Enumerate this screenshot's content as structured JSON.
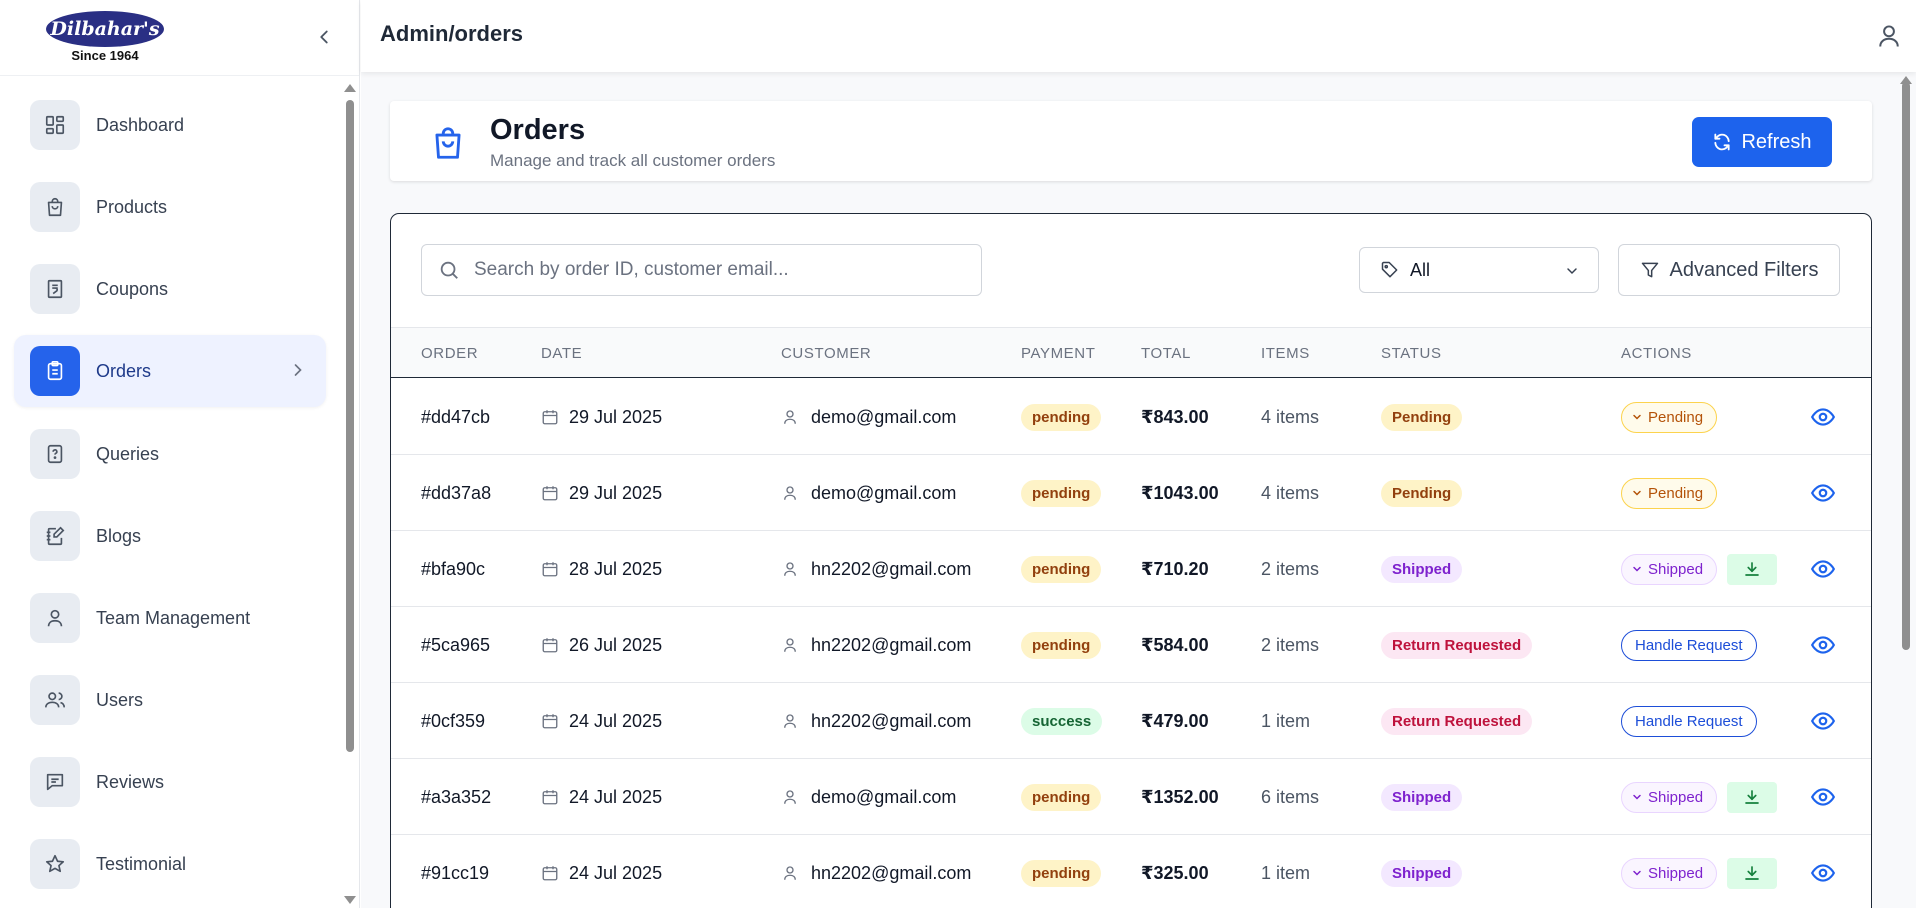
{
  "sidebar": {
    "brand_name": "Dilbahar's",
    "brand_tagline": "Since 1964",
    "items": [
      {
        "label": "Dashboard",
        "icon": "dashboard-icon"
      },
      {
        "label": "Products",
        "icon": "bag-icon"
      },
      {
        "label": "Coupons",
        "icon": "receipt-icon"
      },
      {
        "label": "Orders",
        "icon": "clipboard-icon",
        "active": true
      },
      {
        "label": "Queries",
        "icon": "question-file-icon"
      },
      {
        "label": "Blogs",
        "icon": "notebook-pen-icon"
      },
      {
        "label": "Team Management",
        "icon": "user-icon"
      },
      {
        "label": "Users",
        "icon": "users-icon"
      },
      {
        "label": "Reviews",
        "icon": "message-icon"
      },
      {
        "label": "Testimonial",
        "icon": "star-icon"
      }
    ]
  },
  "topbar": {
    "title": "Admin/orders"
  },
  "orders_header": {
    "title": "Orders",
    "subtitle": "Manage and track all customer orders",
    "refresh_label": "Refresh"
  },
  "filters": {
    "search_placeholder": "Search by order ID, customer email...",
    "status_value": "All",
    "advanced_label": "Advanced Filters"
  },
  "table": {
    "columns": [
      "ORDER",
      "DATE",
      "CUSTOMER",
      "PAYMENT",
      "TOTAL",
      "ITEMS",
      "STATUS",
      "ACTIONS"
    ],
    "rows": [
      {
        "order": "#dd47cb",
        "date": "29 Jul 2025",
        "customer": "demo@gmail.com",
        "payment": "pending",
        "total": "₹843.00",
        "items": "4 items",
        "status": "Pending",
        "action": "Pending",
        "download": false
      },
      {
        "order": "#dd37a8",
        "date": "29 Jul 2025",
        "customer": "demo@gmail.com",
        "payment": "pending",
        "total": "₹1043.00",
        "items": "4 items",
        "status": "Pending",
        "action": "Pending",
        "download": false
      },
      {
        "order": "#bfa90c",
        "date": "28 Jul 2025",
        "customer": "hn2202@gmail.com",
        "payment": "pending",
        "total": "₹710.20",
        "items": "2 items",
        "status": "Shipped",
        "action": "Shipped",
        "download": true
      },
      {
        "order": "#5ca965",
        "date": "26 Jul 2025",
        "customer": "hn2202@gmail.com",
        "payment": "pending",
        "total": "₹584.00",
        "items": "2 items",
        "status": "Return Requested",
        "action": "Handle Request",
        "download": false
      },
      {
        "order": "#0cf359",
        "date": "24 Jul 2025",
        "customer": "hn2202@gmail.com",
        "payment": "success",
        "total": "₹479.00",
        "items": "1 item",
        "status": "Return Requested",
        "action": "Handle Request",
        "download": false
      },
      {
        "order": "#a3a352",
        "date": "24 Jul 2025",
        "customer": "demo@gmail.com",
        "payment": "pending",
        "total": "₹1352.00",
        "items": "6 items",
        "status": "Shipped",
        "action": "Shipped",
        "download": true
      },
      {
        "order": "#91cc19",
        "date": "24 Jul 2025",
        "customer": "hn2202@gmail.com",
        "payment": "pending",
        "total": "₹325.00",
        "items": "1 item",
        "status": "Shipped",
        "action": "Shipped",
        "download": true
      }
    ]
  },
  "colors": {
    "accent": "#1d63ed",
    "sidebar_active_bg": "#eef2ff"
  }
}
